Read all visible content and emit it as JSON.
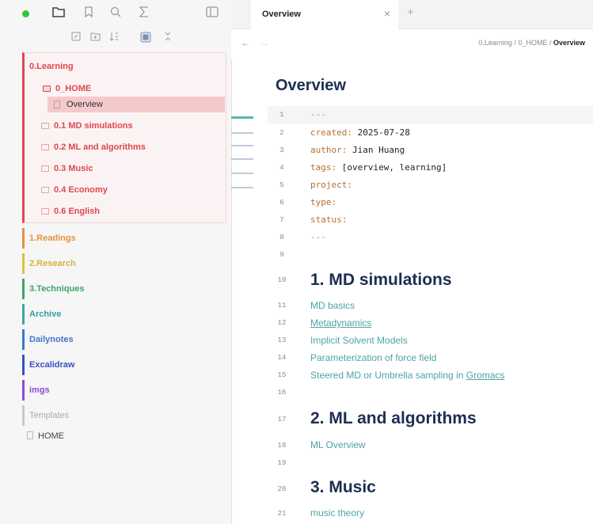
{
  "sidebar": {
    "icons": [
      "folder-icon",
      "bookmark-icon",
      "search-icon",
      "sigma-icon",
      "sidebar-toggle-icon"
    ],
    "toolbar_icons": [
      "new-note-icon",
      "new-folder-icon",
      "sort-icon",
      "collapse-icon",
      "expand-icon"
    ],
    "tree": {
      "learning": "0.Learning",
      "home_folder": "0_HOME",
      "overview_file": "Overview",
      "children": [
        "0.1 MD simulations",
        "0.2 ML and algorithms",
        "0.3 Music",
        "0.4 Economy",
        "0.6 English"
      ],
      "readings": "1.Readings",
      "research": "2.Research",
      "techniques": "3.Techniques",
      "archive": "Archive",
      "dailynotes": "Dailynotes",
      "excalidraw": "Excalidraw",
      "imgs": "imgs",
      "templates": "Templates",
      "home_file": "HOME"
    },
    "colors": {
      "learning": "#e0464e",
      "readings": "#e89040",
      "research": "#e0c040",
      "techniques": "#3ba56d",
      "archive": "#3aa6a6",
      "dailynotes": "#3d76c9",
      "excalidraw": "#3b4fc4",
      "imgs": "#8a4fd0",
      "templates": "#b0b0b0"
    }
  },
  "editor": {
    "tab_title": "Overview",
    "breadcrumb": {
      "part1": "0.Learning",
      "sep": " / ",
      "part2": "0_HOME",
      "current": "Overview"
    },
    "title": "Overview",
    "frontmatter": {
      "fence": "---",
      "created_key": "created:",
      "created_val": " 2025-07-28",
      "author_key": "author:",
      "author_val": " Jian Huang",
      "tags_key": "tags:",
      "tags_val": " [overview, learning]",
      "project_key": "project:",
      "type_key": "type:",
      "status_key": "status:"
    },
    "line_numbers": [
      "1",
      "2",
      "3",
      "4",
      "5",
      "6",
      "7",
      "8",
      "9",
      "10",
      "11",
      "12",
      "13",
      "14",
      "15",
      "16",
      "17",
      "18",
      "19",
      "20",
      "21"
    ],
    "h_md": "1. MD simulations",
    "md_links": [
      "MD basics",
      "Metadynamics",
      "Implicit Solvent Models",
      "Parameterization of force field"
    ],
    "md_link5_a": "Steered MD or Umbrella sampling in ",
    "md_link5_b": "Gromacs",
    "h_ml": "2. ML and algorithms",
    "ml_link": "ML Overview",
    "h_music": "3. Music",
    "music_link": "music theory"
  }
}
